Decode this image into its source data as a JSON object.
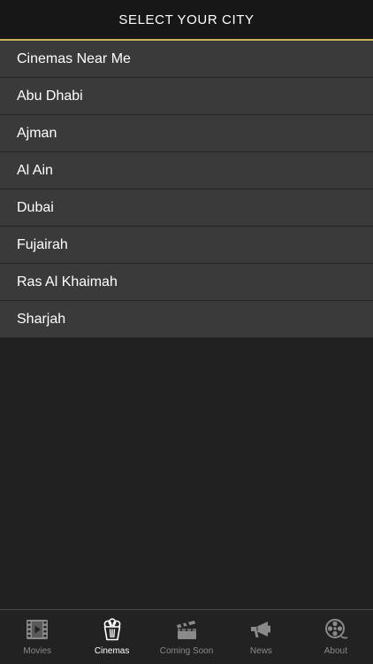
{
  "header": {
    "title": "SELECT YOUR CITY"
  },
  "cities": [
    {
      "label": "Cinemas Near Me"
    },
    {
      "label": "Abu Dhabi"
    },
    {
      "label": "Ajman"
    },
    {
      "label": "Al Ain"
    },
    {
      "label": "Dubai"
    },
    {
      "label": "Fujairah"
    },
    {
      "label": "Ras Al Khaimah"
    },
    {
      "label": "Sharjah"
    }
  ],
  "tabs": [
    {
      "label": "Movies",
      "icon": "film-strip-icon",
      "active": false
    },
    {
      "label": "Cinemas",
      "icon": "popcorn-icon",
      "active": true
    },
    {
      "label": "Coming Soon",
      "icon": "clapperboard-icon",
      "active": false
    },
    {
      "label": "News",
      "icon": "megaphone-icon",
      "active": false
    },
    {
      "label": "About",
      "icon": "film-reel-icon",
      "active": false
    }
  ],
  "colors": {
    "accent": "#c8b55a",
    "header_bg": "#171717",
    "row_bg": "#3a3a3a",
    "page_bg": "#212121",
    "active_tab": "#ffffff",
    "inactive_tab": "#8a8a8a"
  }
}
